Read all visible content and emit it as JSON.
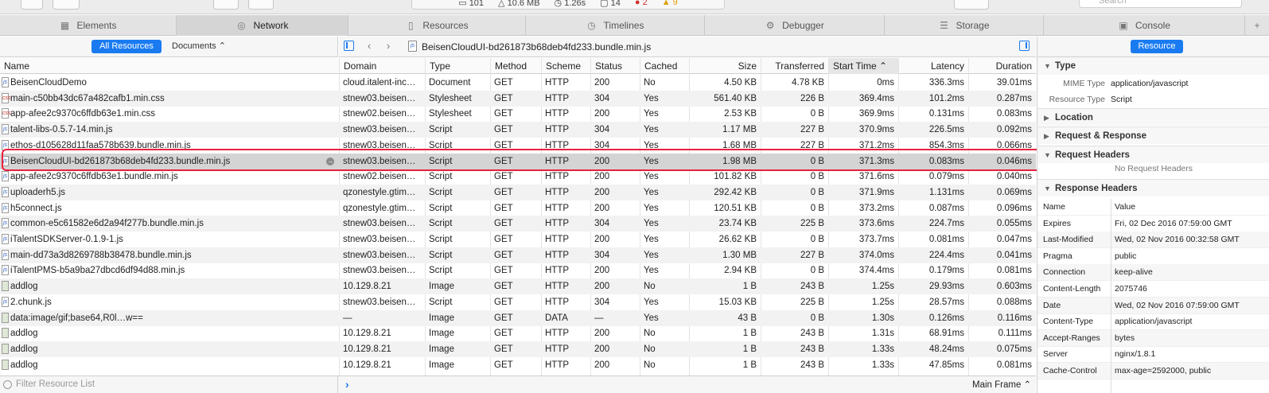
{
  "toolbar": {
    "stats": {
      "requests": "101",
      "size": "10.6 MB",
      "time": "1.26s",
      "logs": "14",
      "errors": "2",
      "warnings": "9"
    },
    "search_placeholder": "Search"
  },
  "tabs": [
    {
      "label": "Elements",
      "icon": "elements-icon"
    },
    {
      "label": "Network",
      "icon": "network-icon",
      "active": true
    },
    {
      "label": "Resources",
      "icon": "resources-icon"
    },
    {
      "label": "Timelines",
      "icon": "timelines-icon"
    },
    {
      "label": "Debugger",
      "icon": "debugger-icon"
    },
    {
      "label": "Storage",
      "icon": "storage-icon"
    },
    {
      "label": "Console",
      "icon": "console-icon"
    }
  ],
  "filter": {
    "all_resources": "All Resources",
    "documents": "Documents ⌃"
  },
  "breadcrumb": "BeisenCloudUI-bd261873b68deb4fd233.bundle.min.js",
  "columns": {
    "name": "Name",
    "domain": "Domain",
    "type": "Type",
    "method": "Method",
    "scheme": "Scheme",
    "status": "Status",
    "cached": "Cached",
    "size": "Size",
    "transferred": "Transferred",
    "start_time": "Start Time",
    "latency": "Latency",
    "duration": "Duration"
  },
  "rows": [
    {
      "name": "BeisenCloudDemo",
      "domain": "cloud.italent-inc…",
      "type": "Document",
      "method": "GET",
      "scheme": "HTTP",
      "status": "200",
      "cached": "No",
      "size": "4.50 KB",
      "transferred": "4.78 KB",
      "start": "0ms",
      "latency": "336.3ms",
      "duration": "39.01ms",
      "icon": "doc"
    },
    {
      "name": "main-c50bb43dc67a482cafb1.min.css",
      "domain": "stnew03.beisen…",
      "type": "Stylesheet",
      "method": "GET",
      "scheme": "HTTP",
      "status": "304",
      "cached": "Yes",
      "size": "561.40 KB",
      "transferred": "226 B",
      "start": "369.4ms",
      "latency": "101.2ms",
      "duration": "0.287ms",
      "icon": "css"
    },
    {
      "name": "app-afee2c9370c6ffdb63e1.min.css",
      "domain": "stnew02.beisen…",
      "type": "Stylesheet",
      "method": "GET",
      "scheme": "HTTP",
      "status": "200",
      "cached": "Yes",
      "size": "2.53 KB",
      "transferred": "0 B",
      "start": "369.9ms",
      "latency": "0.131ms",
      "duration": "0.083ms",
      "icon": "css"
    },
    {
      "name": "talent-libs-0.5.7-14.min.js",
      "domain": "stnew03.beisen…",
      "type": "Script",
      "method": "GET",
      "scheme": "HTTP",
      "status": "304",
      "cached": "Yes",
      "size": "1.17 MB",
      "transferred": "227 B",
      "start": "370.9ms",
      "latency": "226.5ms",
      "duration": "0.092ms",
      "icon": "js"
    },
    {
      "name": "ethos-d105628d11faa578b639.bundle.min.js",
      "domain": "stnew03.beisen…",
      "type": "Script",
      "method": "GET",
      "scheme": "HTTP",
      "status": "304",
      "cached": "Yes",
      "size": "1.68 MB",
      "transferred": "227 B",
      "start": "371.2ms",
      "latency": "854.3ms",
      "duration": "0.066ms",
      "icon": "js"
    },
    {
      "name": "BeisenCloudUI-bd261873b68deb4fd233.bundle.min.js",
      "domain": "stnew03.beisen…",
      "type": "Script",
      "method": "GET",
      "scheme": "HTTP",
      "status": "200",
      "cached": "Yes",
      "size": "1.98 MB",
      "transferred": "0 B",
      "start": "371.3ms",
      "latency": "0.083ms",
      "duration": "0.046ms",
      "icon": "js",
      "selected": true
    },
    {
      "name": "app-afee2c9370c6ffdb63e1.bundle.min.js",
      "domain": "stnew02.beisen…",
      "type": "Script",
      "method": "GET",
      "scheme": "HTTP",
      "status": "200",
      "cached": "Yes",
      "size": "101.82 KB",
      "transferred": "0 B",
      "start": "371.6ms",
      "latency": "0.079ms",
      "duration": "0.040ms",
      "icon": "js"
    },
    {
      "name": "uploaderh5.js",
      "domain": "qzonestyle.gtim…",
      "type": "Script",
      "method": "GET",
      "scheme": "HTTP",
      "status": "200",
      "cached": "Yes",
      "size": "292.42 KB",
      "transferred": "0 B",
      "start": "371.9ms",
      "latency": "1.131ms",
      "duration": "0.069ms",
      "icon": "js"
    },
    {
      "name": "h5connect.js",
      "domain": "qzonestyle.gtim…",
      "type": "Script",
      "method": "GET",
      "scheme": "HTTP",
      "status": "200",
      "cached": "Yes",
      "size": "120.51 KB",
      "transferred": "0 B",
      "start": "373.2ms",
      "latency": "0.087ms",
      "duration": "0.096ms",
      "icon": "js"
    },
    {
      "name": "common-e5c61582e6d2a94f277b.bundle.min.js",
      "domain": "stnew03.beisen…",
      "type": "Script",
      "method": "GET",
      "scheme": "HTTP",
      "status": "304",
      "cached": "Yes",
      "size": "23.74 KB",
      "transferred": "225 B",
      "start": "373.6ms",
      "latency": "224.7ms",
      "duration": "0.055ms",
      "icon": "js"
    },
    {
      "name": "iTalentSDKServer-0.1.9-1.js",
      "domain": "stnew03.beisen…",
      "type": "Script",
      "method": "GET",
      "scheme": "HTTP",
      "status": "200",
      "cached": "Yes",
      "size": "26.62 KB",
      "transferred": "0 B",
      "start": "373.7ms",
      "latency": "0.081ms",
      "duration": "0.047ms",
      "icon": "js"
    },
    {
      "name": "main-dd73a3d8269788b38478.bundle.min.js",
      "domain": "stnew03.beisen…",
      "type": "Script",
      "method": "GET",
      "scheme": "HTTP",
      "status": "304",
      "cached": "Yes",
      "size": "1.30 MB",
      "transferred": "227 B",
      "start": "374.0ms",
      "latency": "224.4ms",
      "duration": "0.041ms",
      "icon": "js"
    },
    {
      "name": "iTalentPMS-b5a9ba27dbcd6df94d88.min.js",
      "domain": "stnew03.beisen…",
      "type": "Script",
      "method": "GET",
      "scheme": "HTTP",
      "status": "200",
      "cached": "Yes",
      "size": "2.94 KB",
      "transferred": "0 B",
      "start": "374.4ms",
      "latency": "0.179ms",
      "duration": "0.081ms",
      "icon": "js"
    },
    {
      "name": "addlog",
      "domain": "10.129.8.21",
      "type": "Image",
      "method": "GET",
      "scheme": "HTTP",
      "status": "200",
      "cached": "No",
      "size": "1 B",
      "transferred": "243 B",
      "start": "1.25s",
      "latency": "29.93ms",
      "duration": "0.603ms",
      "icon": "img"
    },
    {
      "name": "2.chunk.js",
      "domain": "stnew03.beisen…",
      "type": "Script",
      "method": "GET",
      "scheme": "HTTP",
      "status": "304",
      "cached": "Yes",
      "size": "15.03 KB",
      "transferred": "225 B",
      "start": "1.25s",
      "latency": "28.57ms",
      "duration": "0.088ms",
      "icon": "js"
    },
    {
      "name": "data:image/gif;base64,R0l…w==",
      "domain": "—",
      "type": "Image",
      "method": "GET",
      "scheme": "DATA",
      "status": "—",
      "cached": "Yes",
      "size": "43 B",
      "transferred": "0 B",
      "start": "1.30s",
      "latency": "0.126ms",
      "duration": "0.116ms",
      "icon": "img"
    },
    {
      "name": "addlog",
      "domain": "10.129.8.21",
      "type": "Image",
      "method": "GET",
      "scheme": "HTTP",
      "status": "200",
      "cached": "No",
      "size": "1 B",
      "transferred": "243 B",
      "start": "1.31s",
      "latency": "68.91ms",
      "duration": "0.111ms",
      "icon": "img"
    },
    {
      "name": "addlog",
      "domain": "10.129.8.21",
      "type": "Image",
      "method": "GET",
      "scheme": "HTTP",
      "status": "200",
      "cached": "No",
      "size": "1 B",
      "transferred": "243 B",
      "start": "1.33s",
      "latency": "48.24ms",
      "duration": "0.075ms",
      "icon": "img"
    },
    {
      "name": "addlog",
      "domain": "10.129.8.21",
      "type": "Image",
      "method": "GET",
      "scheme": "HTTP",
      "status": "200",
      "cached": "No",
      "size": "1 B",
      "transferred": "243 B",
      "start": "1.33s",
      "latency": "47.85ms",
      "duration": "0.081ms",
      "icon": "img"
    }
  ],
  "bottom": {
    "filter_placeholder": "Filter Resource List",
    "frame_select": "Main Frame ⌃"
  },
  "sidebar": {
    "mode_button": "Resource",
    "type_section": "Type",
    "mime_label": "MIME Type",
    "mime_value": "application/javascript",
    "restype_label": "Resource Type",
    "restype_value": "Script",
    "location_section": "Location",
    "reqresp_section": "Request & Response",
    "reqheaders_section": "Request Headers",
    "no_request_headers": "No Request Headers",
    "respheaders_section": "Response Headers",
    "table_name": "Name",
    "table_value": "Value",
    "response_headers": [
      {
        "k": "Expires",
        "v": "Fri, 02 Dec 2016 07:59:00 GMT"
      },
      {
        "k": "Last-Modified",
        "v": "Wed, 02 Nov 2016 00:32:58 GMT"
      },
      {
        "k": "Pragma",
        "v": "public"
      },
      {
        "k": "Connection",
        "v": "keep-alive"
      },
      {
        "k": "Content-Length",
        "v": "2075746"
      },
      {
        "k": "Date",
        "v": "Wed, 02 Nov 2016 07:59:00 GMT"
      },
      {
        "k": "Content-Type",
        "v": "application/javascript"
      },
      {
        "k": "Accept-Ranges",
        "v": "bytes"
      },
      {
        "k": "Server",
        "v": "nginx/1.8.1"
      },
      {
        "k": "Cache-Control",
        "v": "max-age=2592000, public"
      }
    ]
  },
  "colors": {
    "accent": "#1a7bf1",
    "highlight_border": "#e8213e",
    "error": "#d62d2d",
    "warning": "#e0a100"
  }
}
